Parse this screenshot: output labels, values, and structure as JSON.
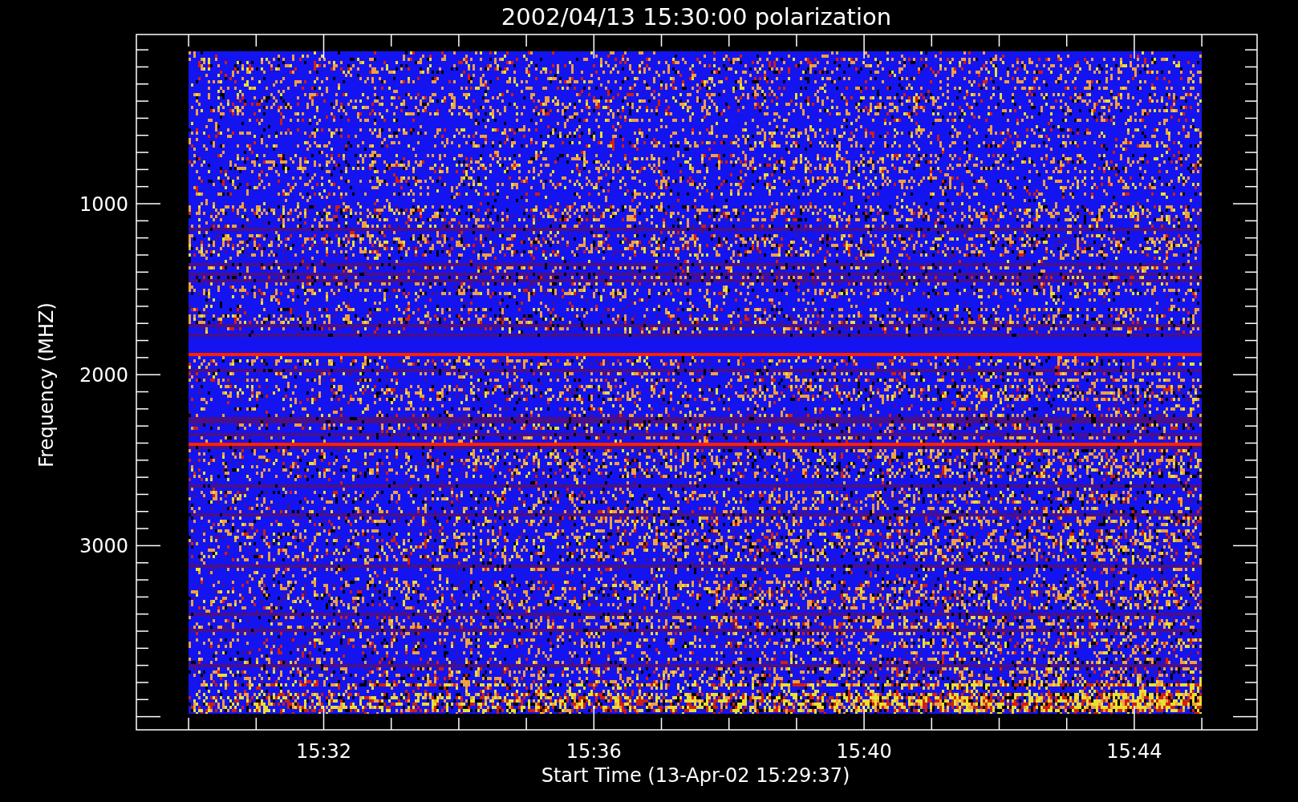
{
  "title": "2002/04/13 15:30:00 polarization",
  "x_axis": {
    "label": "Start Time (13-Apr-02 15:29:37)",
    "ticks": [
      "15:32",
      "15:36",
      "15:40",
      "15:44"
    ]
  },
  "y_axis": {
    "label": "Frequency (MHZ)",
    "ticks": [
      "1000",
      "2000",
      "3000"
    ]
  }
}
